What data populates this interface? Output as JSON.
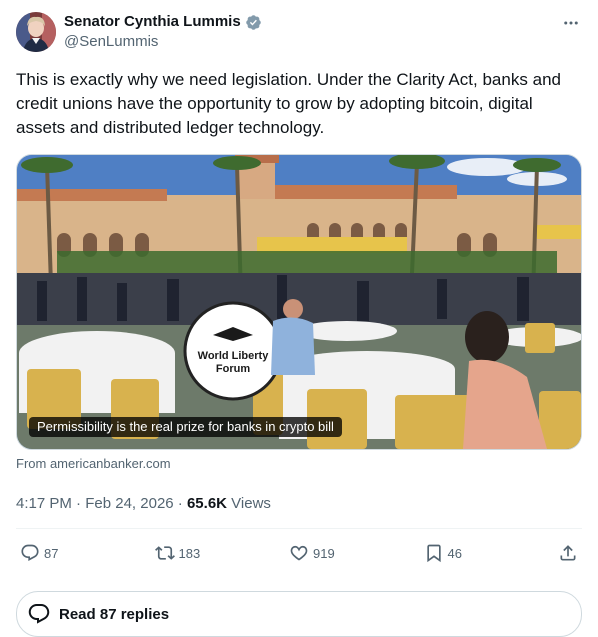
{
  "author": {
    "display_name": "Senator Cynthia Lummis",
    "handle": "@SenLummis",
    "verified": true,
    "verified_color": "#829aab"
  },
  "tweet": {
    "text": "This is exactly why we need legislation. Under the Clarity Act, banks and credit unions have the opportunity to grow by adopting bitcoin, digital assets and distributed ledger technology."
  },
  "card": {
    "caption": "Permissibility is the real prize for banks in crypto bill",
    "source": "From americanbanker.com",
    "sign_text_line1": "World Liberty",
    "sign_text_line2": "Forum"
  },
  "meta": {
    "time": "4:17 PM",
    "separator1": " · ",
    "date": "Feb 24, 2026",
    "separator2": " · ",
    "views_count": "65.6K",
    "views_label": " Views"
  },
  "actions": {
    "replies": "87",
    "reposts": "183",
    "likes": "919",
    "bookmarks": "46"
  },
  "replies_button": {
    "label": "Read 87 replies"
  },
  "colors": {
    "text_primary": "#0f1419",
    "text_secondary": "#536471",
    "border": "#cfd9de",
    "divider": "#eff3f4"
  },
  "icons": {
    "more": "more-dots-icon",
    "reply": "reply-bubble-icon",
    "repost": "repost-arrows-icon",
    "like": "heart-icon",
    "bookmark": "bookmark-icon",
    "share": "share-upload-icon",
    "verified": "verified-badge-icon"
  }
}
